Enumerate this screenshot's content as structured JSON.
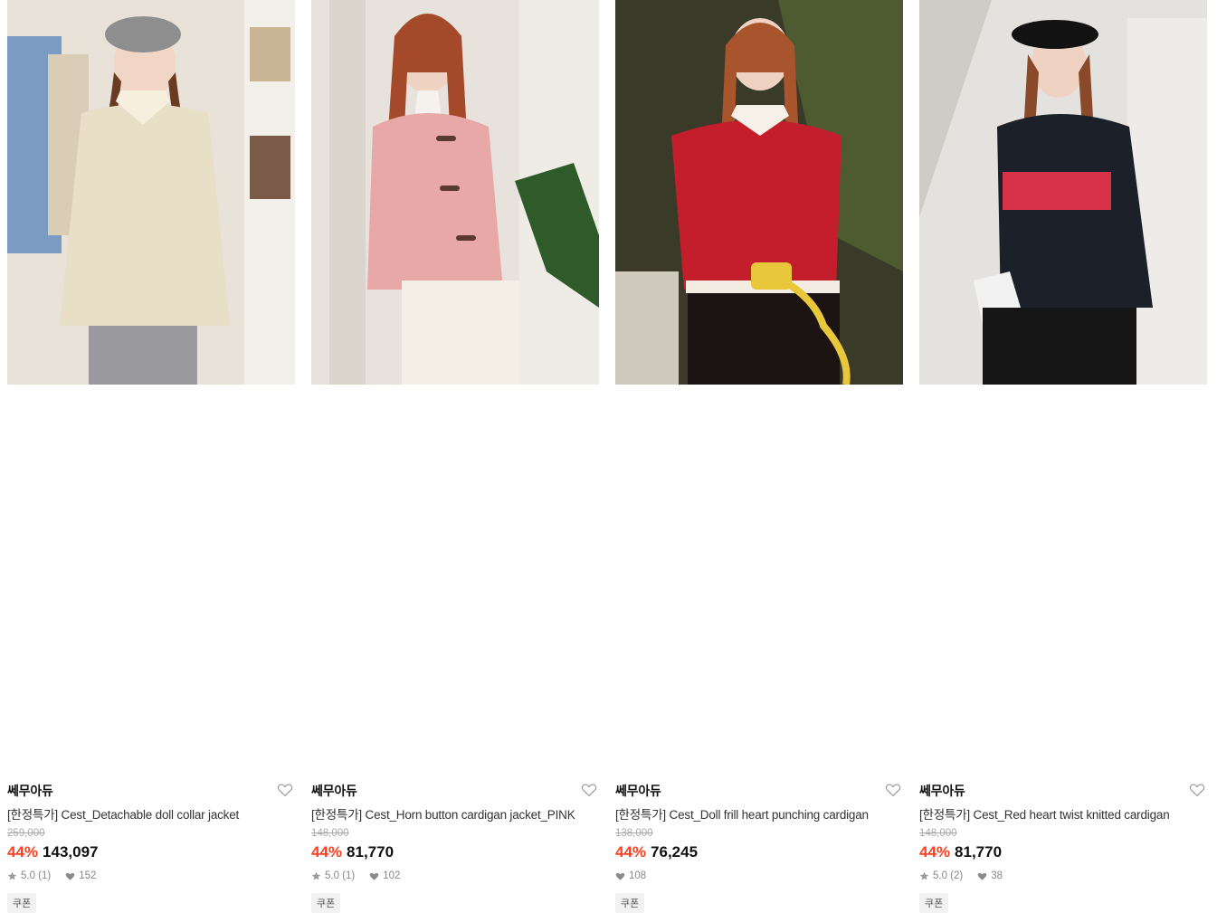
{
  "products": [
    {
      "brand": "쎄무아듀",
      "name": "[한정특가] Cest_Detachable doll collar jacket",
      "original_price": "259,000",
      "discount": "44%",
      "price": "143,097",
      "rating": "5.0 (1)",
      "likes": "152",
      "badge": "쿠폰",
      "colors": {
        "bg": "#e8e2d8",
        "garment": "#e9dfc6",
        "hair": "#6b3a22",
        "accent": "#8a8a8a"
      }
    },
    {
      "brand": "쎄무아듀",
      "name": "[한정특가] Cest_Horn button cardigan jacket_PINK",
      "original_price": "148,000",
      "discount": "44%",
      "price": "81,770",
      "rating": "5.0 (1)",
      "likes": "102",
      "badge": "쿠폰",
      "colors": {
        "bg": "#e7e3dc",
        "garment": "#e9a8a8",
        "hair": "#a4492a",
        "accent": "#2f5a2a"
      }
    },
    {
      "brand": "쎄무아듀",
      "name": "[한정특가] Cest_Doll frill heart punching cardigan",
      "original_price": "138,000",
      "discount": "44%",
      "price": "76,245",
      "rating": "",
      "likes": "108",
      "badge": "쿠폰",
      "colors": {
        "bg": "#3a3a28",
        "garment": "#c41d2b",
        "hair": "#a8542d",
        "accent": "#e8c83a"
      }
    },
    {
      "brand": "쎄무아듀",
      "name": "[한정특가] Cest_Red heart twist knitted cardigan",
      "original_price": "148,000",
      "discount": "44%",
      "price": "81,770",
      "rating": "5.0 (2)",
      "likes": "38",
      "badge": "쿠폰",
      "colors": {
        "bg": "#e4e2de",
        "garment": "#1c2029",
        "hair": "#8a4a2a",
        "accent": "#d8324a"
      }
    }
  ]
}
